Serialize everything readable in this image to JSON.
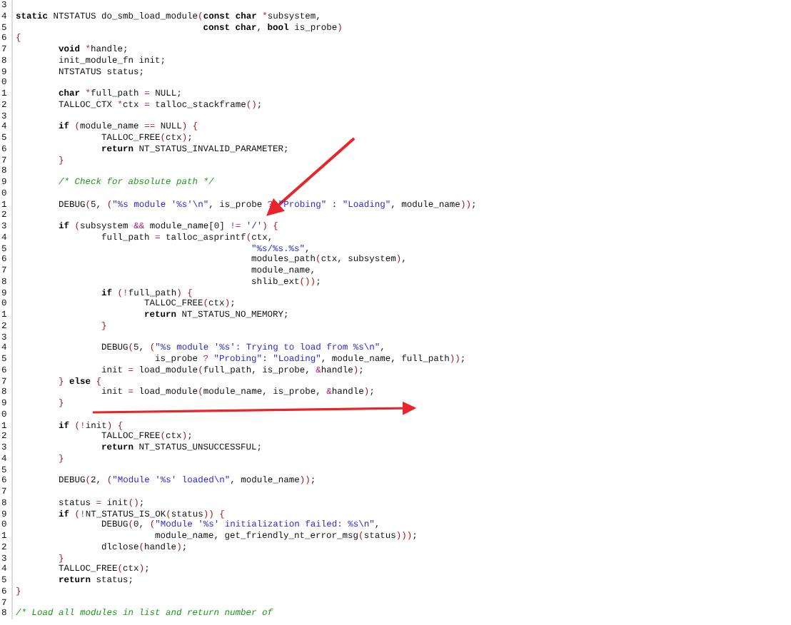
{
  "code_lines": [
    {
      "n": "3"
    },
    {
      "n": "4",
      "tokens": [
        {
          "text": "static",
          "kind": "keyword"
        },
        {
          "text": " NTSTATUS do_smb_load_module",
          "kind": "plain"
        },
        {
          "text": "(",
          "kind": "paren"
        },
        {
          "text": "const char",
          "kind": "keyword"
        },
        {
          "text": " *",
          "kind": "operator"
        },
        {
          "text": "subsystem,",
          "kind": "plain"
        }
      ]
    },
    {
      "n": "5",
      "tokens": [
        {
          "text": "                                   const char",
          "kind": "keyword"
        },
        {
          "text": ", ",
          "kind": "plain"
        },
        {
          "text": "bool",
          "kind": "keyword"
        },
        {
          "text": " is_probe",
          "kind": "plain"
        },
        {
          "text": ")",
          "kind": "paren"
        }
      ]
    },
    {
      "n": "6",
      "tokens": [
        {
          "text": "{",
          "kind": "paren"
        }
      ]
    },
    {
      "n": "7",
      "tokens": [
        {
          "text": "\tvoid",
          "kind": "keyword"
        },
        {
          "text": " *",
          "kind": "operator"
        },
        {
          "text": "handle;",
          "kind": "plain"
        }
      ]
    },
    {
      "n": "8",
      "tokens": [
        {
          "text": "\tinit_module_fn init;",
          "kind": "plain"
        }
      ]
    },
    {
      "n": "9",
      "tokens": [
        {
          "text": "\tNTSTATUS status;",
          "kind": "plain"
        }
      ]
    },
    {
      "n": "0"
    },
    {
      "n": "1",
      "tokens": [
        {
          "text": "\tchar",
          "kind": "keyword"
        },
        {
          "text": " *",
          "kind": "operator"
        },
        {
          "text": "full_path ",
          "kind": "plain"
        },
        {
          "text": "=",
          "kind": "operator"
        },
        {
          "text": " NULL;",
          "kind": "plain"
        }
      ]
    },
    {
      "n": "2",
      "tokens": [
        {
          "text": "\tTALLOC_CTX ",
          "kind": "plain"
        },
        {
          "text": "*",
          "kind": "operator"
        },
        {
          "text": "ctx ",
          "kind": "plain"
        },
        {
          "text": "=",
          "kind": "operator"
        },
        {
          "text": " talloc_stackframe",
          "kind": "plain"
        },
        {
          "text": "()",
          "kind": "paren"
        },
        {
          "text": ";",
          "kind": "plain"
        }
      ]
    },
    {
      "n": "3"
    },
    {
      "n": "4",
      "tokens": [
        {
          "text": "\tif",
          "kind": "keyword"
        },
        {
          "text": " (",
          "kind": "paren"
        },
        {
          "text": "module_name ",
          "kind": "plain"
        },
        {
          "text": "==",
          "kind": "operator"
        },
        {
          "text": " NULL",
          "kind": "plain"
        },
        {
          "text": ") {",
          "kind": "paren"
        }
      ]
    },
    {
      "n": "5",
      "tokens": [
        {
          "text": "\t\tTALLOC_FREE",
          "kind": "plain"
        },
        {
          "text": "(",
          "kind": "paren"
        },
        {
          "text": "ctx",
          "kind": "plain"
        },
        {
          "text": ")",
          "kind": "paren"
        },
        {
          "text": ";",
          "kind": "plain"
        }
      ]
    },
    {
      "n": "6",
      "tokens": [
        {
          "text": "\t\treturn",
          "kind": "keyword"
        },
        {
          "text": " NT_STATUS_INVALID_PARAMETER;",
          "kind": "plain"
        }
      ]
    },
    {
      "n": "7",
      "tokens": [
        {
          "text": "\t}",
          "kind": "paren"
        }
      ]
    },
    {
      "n": "8"
    },
    {
      "n": "9",
      "tokens": [
        {
          "text": "\t/* Check for absolute path */",
          "kind": "comment"
        }
      ]
    },
    {
      "n": "0"
    },
    {
      "n": "1",
      "tokens": [
        {
          "text": "\tDEBUG",
          "kind": "plain"
        },
        {
          "text": "(",
          "kind": "paren"
        },
        {
          "text": "5, ",
          "kind": "plain"
        },
        {
          "text": "(",
          "kind": "paren"
        },
        {
          "text": "\"%s module '%s'\\n\"",
          "kind": "string"
        },
        {
          "text": ", is_probe ",
          "kind": "plain"
        },
        {
          "text": "?",
          "kind": "operator"
        },
        {
          "text": " \"Probing\"",
          "kind": "string"
        },
        {
          "text": " : ",
          "kind": "plain"
        },
        {
          "text": "\"Loading\"",
          "kind": "string"
        },
        {
          "text": ", module_name",
          "kind": "plain"
        },
        {
          "text": "))",
          "kind": "paren"
        },
        {
          "text": ";",
          "kind": "plain"
        }
      ]
    },
    {
      "n": "2"
    },
    {
      "n": "3",
      "tokens": [
        {
          "text": "\tif",
          "kind": "keyword"
        },
        {
          "text": " (",
          "kind": "paren"
        },
        {
          "text": "subsystem ",
          "kind": "plain"
        },
        {
          "text": "&&",
          "kind": "operator"
        },
        {
          "text": " module_name[0] ",
          "kind": "plain"
        },
        {
          "text": "!=",
          "kind": "operator"
        },
        {
          "text": " '/'",
          "kind": "string"
        },
        {
          "text": ") {",
          "kind": "paren"
        }
      ]
    },
    {
      "n": "4",
      "tokens": [
        {
          "text": "\t\tfull_path ",
          "kind": "plain"
        },
        {
          "text": "=",
          "kind": "operator"
        },
        {
          "text": " talloc_asprintf",
          "kind": "plain"
        },
        {
          "text": "(",
          "kind": "paren"
        },
        {
          "text": "ctx,",
          "kind": "plain"
        }
      ]
    },
    {
      "n": "5",
      "tokens": [
        {
          "text": "\t\t\t\t\t    \"%s/%s.%s\"",
          "kind": "string"
        },
        {
          "text": ",",
          "kind": "plain"
        }
      ]
    },
    {
      "n": "6",
      "tokens": [
        {
          "text": "\t\t\t\t\t    modules_path",
          "kind": "plain"
        },
        {
          "text": "(",
          "kind": "paren"
        },
        {
          "text": "ctx, subsystem",
          "kind": "plain"
        },
        {
          "text": ")",
          "kind": "paren"
        },
        {
          "text": ",",
          "kind": "plain"
        }
      ]
    },
    {
      "n": "7",
      "tokens": [
        {
          "text": "\t\t\t\t\t    module_name,",
          "kind": "plain"
        }
      ]
    },
    {
      "n": "8",
      "tokens": [
        {
          "text": "\t\t\t\t\t    shlib_ext",
          "kind": "plain"
        },
        {
          "text": "())",
          "kind": "paren"
        },
        {
          "text": ";",
          "kind": "plain"
        }
      ]
    },
    {
      "n": "9",
      "tokens": [
        {
          "text": "\t\tif",
          "kind": "keyword"
        },
        {
          "text": " (",
          "kind": "paren"
        },
        {
          "text": "!",
          "kind": "operator"
        },
        {
          "text": "full_path",
          "kind": "plain"
        },
        {
          "text": ") {",
          "kind": "paren"
        }
      ]
    },
    {
      "n": "0",
      "tokens": [
        {
          "text": "\t\t\tTALLOC_FREE",
          "kind": "plain"
        },
        {
          "text": "(",
          "kind": "paren"
        },
        {
          "text": "ctx",
          "kind": "plain"
        },
        {
          "text": ")",
          "kind": "paren"
        },
        {
          "text": ";",
          "kind": "plain"
        }
      ]
    },
    {
      "n": "1",
      "tokens": [
        {
          "text": "\t\t\treturn",
          "kind": "keyword"
        },
        {
          "text": " NT_STATUS_NO_MEMORY;",
          "kind": "plain"
        }
      ]
    },
    {
      "n": "2",
      "tokens": [
        {
          "text": "\t\t}",
          "kind": "paren"
        }
      ]
    },
    {
      "n": "3"
    },
    {
      "n": "4",
      "tokens": [
        {
          "text": "\t\tDEBUG",
          "kind": "plain"
        },
        {
          "text": "(",
          "kind": "paren"
        },
        {
          "text": "5, ",
          "kind": "plain"
        },
        {
          "text": "(",
          "kind": "paren"
        },
        {
          "text": "\"%s module '%s': Trying to load from %s\\n\"",
          "kind": "string"
        },
        {
          "text": ",",
          "kind": "plain"
        }
      ]
    },
    {
      "n": "5",
      "tokens": [
        {
          "text": "\t\t\t  is_probe ",
          "kind": "plain"
        },
        {
          "text": "?",
          "kind": "operator"
        },
        {
          "text": " \"Probing\"",
          "kind": "string"
        },
        {
          "text": ": ",
          "kind": "plain"
        },
        {
          "text": "\"Loading\"",
          "kind": "string"
        },
        {
          "text": ", module_name, full_path",
          "kind": "plain"
        },
        {
          "text": "))",
          "kind": "paren"
        },
        {
          "text": ";",
          "kind": "plain"
        }
      ]
    },
    {
      "n": "6",
      "tokens": [
        {
          "text": "\t\tinit ",
          "kind": "plain"
        },
        {
          "text": "=",
          "kind": "operator"
        },
        {
          "text": " load_module",
          "kind": "plain"
        },
        {
          "text": "(",
          "kind": "paren"
        },
        {
          "text": "full_path, is_probe, ",
          "kind": "plain"
        },
        {
          "text": "&",
          "kind": "operator"
        },
        {
          "text": "handle",
          "kind": "plain"
        },
        {
          "text": ")",
          "kind": "paren"
        },
        {
          "text": ";",
          "kind": "plain"
        }
      ]
    },
    {
      "n": "7",
      "tokens": [
        {
          "text": "\t}",
          "kind": "paren"
        },
        {
          "text": " else",
          "kind": "keyword"
        },
        {
          "text": " {",
          "kind": "paren"
        }
      ]
    },
    {
      "n": "8",
      "tokens": [
        {
          "text": "\t\tinit ",
          "kind": "plain"
        },
        {
          "text": "=",
          "kind": "operator"
        },
        {
          "text": " load_module",
          "kind": "plain"
        },
        {
          "text": "(",
          "kind": "paren"
        },
        {
          "text": "module_name, is_probe, ",
          "kind": "plain"
        },
        {
          "text": "&",
          "kind": "operator"
        },
        {
          "text": "handle",
          "kind": "plain"
        },
        {
          "text": ")",
          "kind": "paren"
        },
        {
          "text": ";",
          "kind": "plain"
        }
      ]
    },
    {
      "n": "9",
      "tokens": [
        {
          "text": "\t}",
          "kind": "paren"
        }
      ]
    },
    {
      "n": "0"
    },
    {
      "n": "1",
      "tokens": [
        {
          "text": "\tif",
          "kind": "keyword"
        },
        {
          "text": " (",
          "kind": "paren"
        },
        {
          "text": "!",
          "kind": "operator"
        },
        {
          "text": "init",
          "kind": "plain"
        },
        {
          "text": ") {",
          "kind": "paren"
        }
      ]
    },
    {
      "n": "2",
      "tokens": [
        {
          "text": "\t\tTALLOC_FREE",
          "kind": "plain"
        },
        {
          "text": "(",
          "kind": "paren"
        },
        {
          "text": "ctx",
          "kind": "plain"
        },
        {
          "text": ")",
          "kind": "paren"
        },
        {
          "text": ";",
          "kind": "plain"
        }
      ]
    },
    {
      "n": "3",
      "tokens": [
        {
          "text": "\t\treturn",
          "kind": "keyword"
        },
        {
          "text": " NT_STATUS_UNSUCCESSFUL;",
          "kind": "plain"
        }
      ]
    },
    {
      "n": "4",
      "tokens": [
        {
          "text": "\t}",
          "kind": "paren"
        }
      ]
    },
    {
      "n": "5"
    },
    {
      "n": "6",
      "tokens": [
        {
          "text": "\tDEBUG",
          "kind": "plain"
        },
        {
          "text": "(",
          "kind": "paren"
        },
        {
          "text": "2, ",
          "kind": "plain"
        },
        {
          "text": "(",
          "kind": "paren"
        },
        {
          "text": "\"Module '%s' loaded\\n\"",
          "kind": "string"
        },
        {
          "text": ", module_name",
          "kind": "plain"
        },
        {
          "text": "))",
          "kind": "paren"
        },
        {
          "text": ";",
          "kind": "plain"
        }
      ]
    },
    {
      "n": "7"
    },
    {
      "n": "8",
      "tokens": [
        {
          "text": "\tstatus ",
          "kind": "plain"
        },
        {
          "text": "=",
          "kind": "operator"
        },
        {
          "text": " init",
          "kind": "plain"
        },
        {
          "text": "()",
          "kind": "paren"
        },
        {
          "text": ";",
          "kind": "plain"
        }
      ]
    },
    {
      "n": "9",
      "tokens": [
        {
          "text": "\tif",
          "kind": "keyword"
        },
        {
          "text": " (",
          "kind": "paren"
        },
        {
          "text": "!",
          "kind": "operator"
        },
        {
          "text": "NT_STATUS_IS_OK",
          "kind": "plain"
        },
        {
          "text": "(",
          "kind": "paren"
        },
        {
          "text": "status",
          "kind": "plain"
        },
        {
          "text": ")) {",
          "kind": "paren"
        }
      ]
    },
    {
      "n": "0",
      "tokens": [
        {
          "text": "\t\tDEBUG",
          "kind": "plain"
        },
        {
          "text": "(",
          "kind": "paren"
        },
        {
          "text": "0, ",
          "kind": "plain"
        },
        {
          "text": "(",
          "kind": "paren"
        },
        {
          "text": "\"Module '%s' initialization failed: %s\\n\"",
          "kind": "string"
        },
        {
          "text": ",",
          "kind": "plain"
        }
      ]
    },
    {
      "n": "1",
      "tokens": [
        {
          "text": "\t\t\t  module_name, get_friendly_nt_error_msg",
          "kind": "plain"
        },
        {
          "text": "(",
          "kind": "paren"
        },
        {
          "text": "status",
          "kind": "plain"
        },
        {
          "text": ")))",
          "kind": "paren"
        },
        {
          "text": ";",
          "kind": "plain"
        }
      ]
    },
    {
      "n": "2",
      "tokens": [
        {
          "text": "\t\tdlclose",
          "kind": "plain"
        },
        {
          "text": "(",
          "kind": "paren"
        },
        {
          "text": "handle",
          "kind": "plain"
        },
        {
          "text": ")",
          "kind": "paren"
        },
        {
          "text": ";",
          "kind": "plain"
        }
      ]
    },
    {
      "n": "3",
      "tokens": [
        {
          "text": "\t}",
          "kind": "paren"
        }
      ]
    },
    {
      "n": "4",
      "tokens": [
        {
          "text": "\tTALLOC_FREE",
          "kind": "plain"
        },
        {
          "text": "(",
          "kind": "paren"
        },
        {
          "text": "ctx",
          "kind": "plain"
        },
        {
          "text": ")",
          "kind": "paren"
        },
        {
          "text": ";",
          "kind": "plain"
        }
      ]
    },
    {
      "n": "5",
      "tokens": [
        {
          "text": "\treturn",
          "kind": "keyword"
        },
        {
          "text": " status;",
          "kind": "plain"
        }
      ]
    },
    {
      "n": "6",
      "tokens": [
        {
          "text": "}",
          "kind": "paren"
        }
      ]
    },
    {
      "n": "7"
    },
    {
      "n": "8",
      "tokens": [
        {
          "text": "/* Load all modules in list and return number of",
          "kind": "comment"
        }
      ]
    }
  ]
}
